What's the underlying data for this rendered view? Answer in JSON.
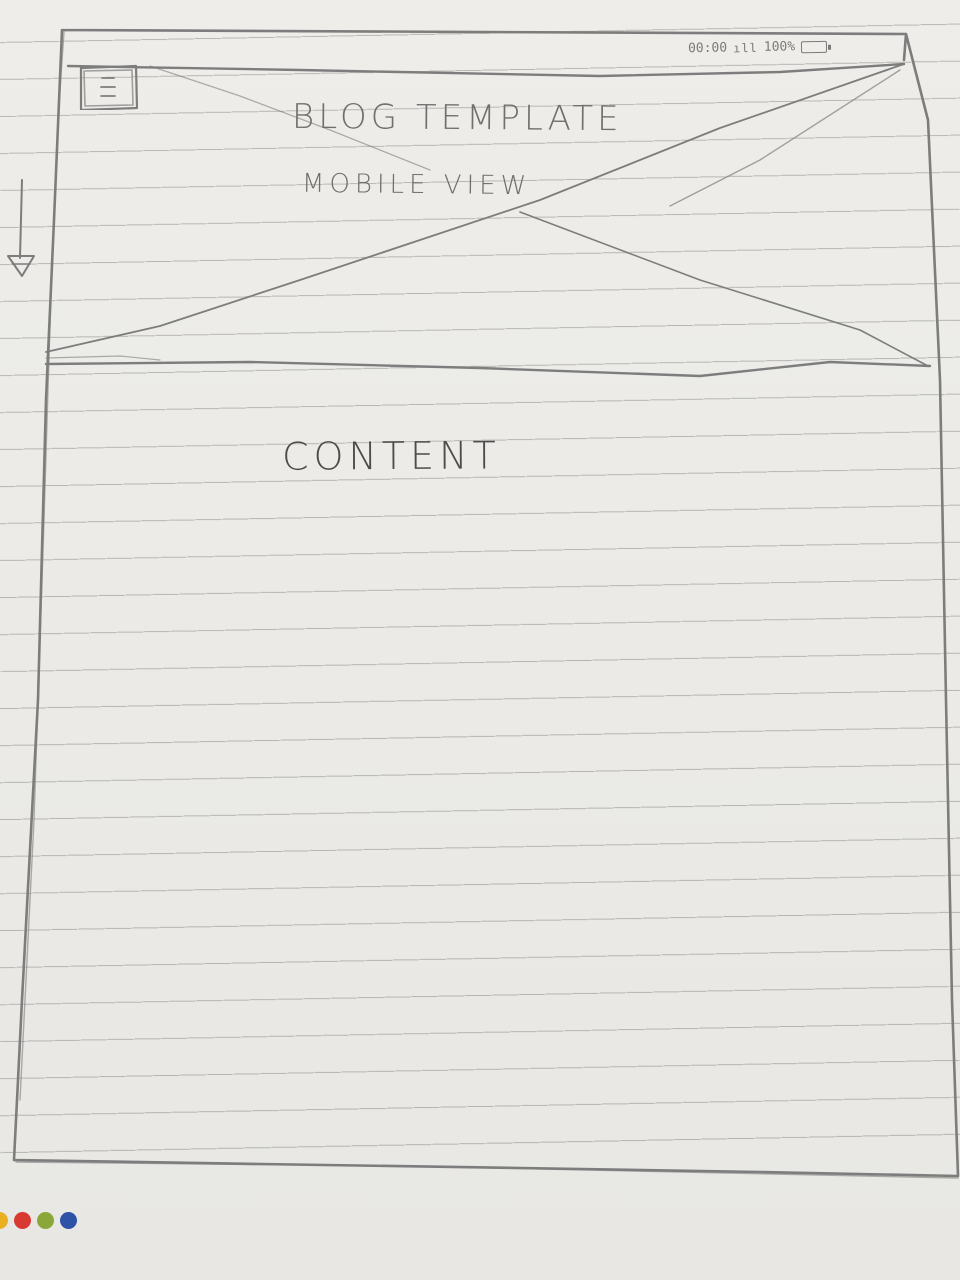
{
  "header": {
    "title": "BLOG TEMPLATE",
    "subtitle": "MOBILE VIEW"
  },
  "status_bar": {
    "time": "00:00",
    "signal": "ıll",
    "battery_percent": "100%"
  },
  "main": {
    "content_label": "CONTENT"
  },
  "icons": {
    "menu": "hamburger-menu-icon",
    "scroll": "scroll-down-arrow-icon",
    "battery": "battery-icon",
    "hero_placeholder": "image-placeholder-cross"
  },
  "brand_dots": {
    "colors": [
      "#e8b020",
      "#d83a32",
      "#8aa83a",
      "#2e52a8"
    ]
  }
}
